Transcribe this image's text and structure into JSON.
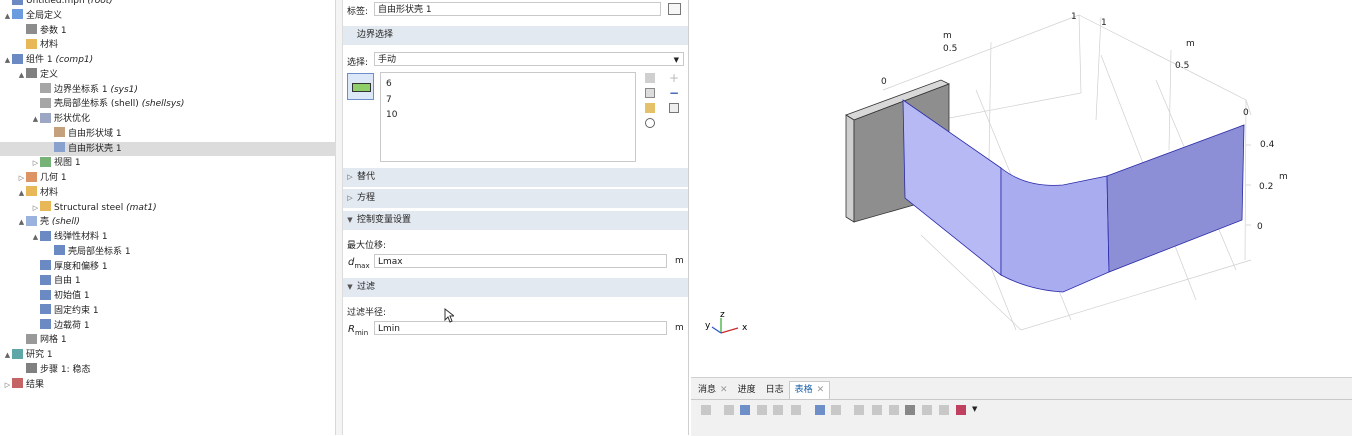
{
  "tree": {
    "items": [
      {
        "label": "Untitled.mph",
        "suffix": "(root)",
        "indent": 0,
        "tw": "",
        "icon": "root-file-icon"
      },
      {
        "label": "全局定义",
        "suffix": "",
        "indent": 0,
        "tw": "▲",
        "icon": "globe-icon"
      },
      {
        "label": "参数 1",
        "suffix": "",
        "indent": 1,
        "tw": "",
        "icon": "parameters-icon"
      },
      {
        "label": "材料",
        "suffix": "",
        "indent": 1,
        "tw": "",
        "icon": "materials-icon"
      },
      {
        "label": "组件 1",
        "suffix": "(comp1)",
        "indent": 0,
        "tw": "▲",
        "icon": "component-icon"
      },
      {
        "label": "定义",
        "suffix": "",
        "indent": 1,
        "tw": "▲",
        "icon": "definitions-icon"
      },
      {
        "label": "边界坐标系 1",
        "suffix": "(sys1)",
        "indent": 2,
        "tw": "",
        "icon": "coordinate-system-icon"
      },
      {
        "label": "壳局部坐标系 (shell)",
        "suffix": "(shellsys)",
        "indent": 2,
        "tw": "",
        "icon": "coordinate-system-icon"
      },
      {
        "label": "形状优化",
        "suffix": "",
        "indent": 2,
        "tw": "▲",
        "icon": "shape-optimization-icon"
      },
      {
        "label": "自由形状域 1",
        "suffix": "",
        "indent": 3,
        "tw": "",
        "icon": "free-shape-domain-icon"
      },
      {
        "label": "自由形状壳 1",
        "suffix": "",
        "indent": 3,
        "tw": "",
        "icon": "free-shape-shell-icon",
        "selected": true
      },
      {
        "label": "视图 1",
        "suffix": "",
        "indent": 2,
        "tw": "▷",
        "icon": "view-icon"
      },
      {
        "label": "几何 1",
        "suffix": "",
        "indent": 1,
        "tw": "▷",
        "icon": "geometry-icon"
      },
      {
        "label": "材料",
        "suffix": "",
        "indent": 1,
        "tw": "▲",
        "icon": "materials-icon"
      },
      {
        "label": "Structural steel",
        "suffix": "(mat1)",
        "indent": 2,
        "tw": "▷",
        "icon": "material-icon"
      },
      {
        "label": "壳",
        "suffix": "(shell)",
        "indent": 1,
        "tw": "▲",
        "icon": "shell-physics-icon"
      },
      {
        "label": "线弹性材料 1",
        "suffix": "",
        "indent": 2,
        "tw": "▲",
        "icon": "linear-elastic-icon"
      },
      {
        "label": "壳局部坐标系 1",
        "suffix": "",
        "indent": 3,
        "tw": "",
        "icon": "local-coordinate-icon"
      },
      {
        "label": "厚度和偏移 1",
        "suffix": "",
        "indent": 2,
        "tw": "",
        "icon": "thickness-icon"
      },
      {
        "label": "自由 1",
        "suffix": "",
        "indent": 2,
        "tw": "",
        "icon": "free-icon"
      },
      {
        "label": "初始值 1",
        "suffix": "",
        "indent": 2,
        "tw": "",
        "icon": "initial-values-icon"
      },
      {
        "label": "固定约束 1",
        "suffix": "",
        "indent": 2,
        "tw": "",
        "icon": "fixed-constraint-icon"
      },
      {
        "label": "边载荷 1",
        "suffix": "",
        "indent": 2,
        "tw": "",
        "icon": "edge-load-icon"
      },
      {
        "label": "网格 1",
        "suffix": "",
        "indent": 1,
        "tw": "",
        "icon": "mesh-icon"
      },
      {
        "label": "研究 1",
        "suffix": "",
        "indent": 0,
        "tw": "▲",
        "icon": "study-icon"
      },
      {
        "label": "步骤 1: 稳态",
        "suffix": "",
        "indent": 1,
        "tw": "",
        "icon": "step-icon"
      },
      {
        "label": "结果",
        "suffix": "",
        "indent": 0,
        "tw": "▷",
        "icon": "results-icon"
      }
    ]
  },
  "settings": {
    "label_caption": "标签:",
    "label_value": "自由形状壳 1",
    "boundary_section": "边界选择",
    "select_caption": "选择:",
    "select_value": "手动",
    "boundaries": [
      "6",
      "7",
      "10"
    ],
    "section_replace": "替代",
    "section_equation": "方程",
    "section_control": "控制变量设置",
    "max_disp_caption": "最大位移:",
    "max_disp_symbol": "d",
    "max_disp_sub": "max",
    "max_disp_value": "Lmax",
    "max_disp_unit": "m",
    "section_filter": "过滤",
    "filter_caption": "过滤半径:",
    "filter_symbol": "R",
    "filter_sub": "min",
    "filter_value": "Lmin",
    "filter_unit": "m"
  },
  "graphics": {
    "axis_labels": {
      "top_1a": "1",
      "top_1b": "1",
      "m_a": "m",
      "m_b": "m",
      "m_right": "m",
      "v05a": "0.5",
      "v05b": "0.5",
      "v0": "0",
      "r0": "0",
      "r04": "0.4",
      "r02": "0.2",
      "r0b": "0"
    },
    "triad": {
      "x": "x",
      "y": "y",
      "z": "z"
    },
    "colors": {
      "shell": "#b6b9f4",
      "shell_dark": "#8c8ed6",
      "wall": "#8e8e8e",
      "edge": "#2a2aa8"
    }
  },
  "bottom": {
    "tabs": [
      {
        "label": "消息",
        "closable": true,
        "active": false
      },
      {
        "label": "进度",
        "closable": false,
        "active": false
      },
      {
        "label": "日志",
        "closable": false,
        "active": false
      },
      {
        "label": "表格",
        "closable": true,
        "active": true
      }
    ]
  }
}
